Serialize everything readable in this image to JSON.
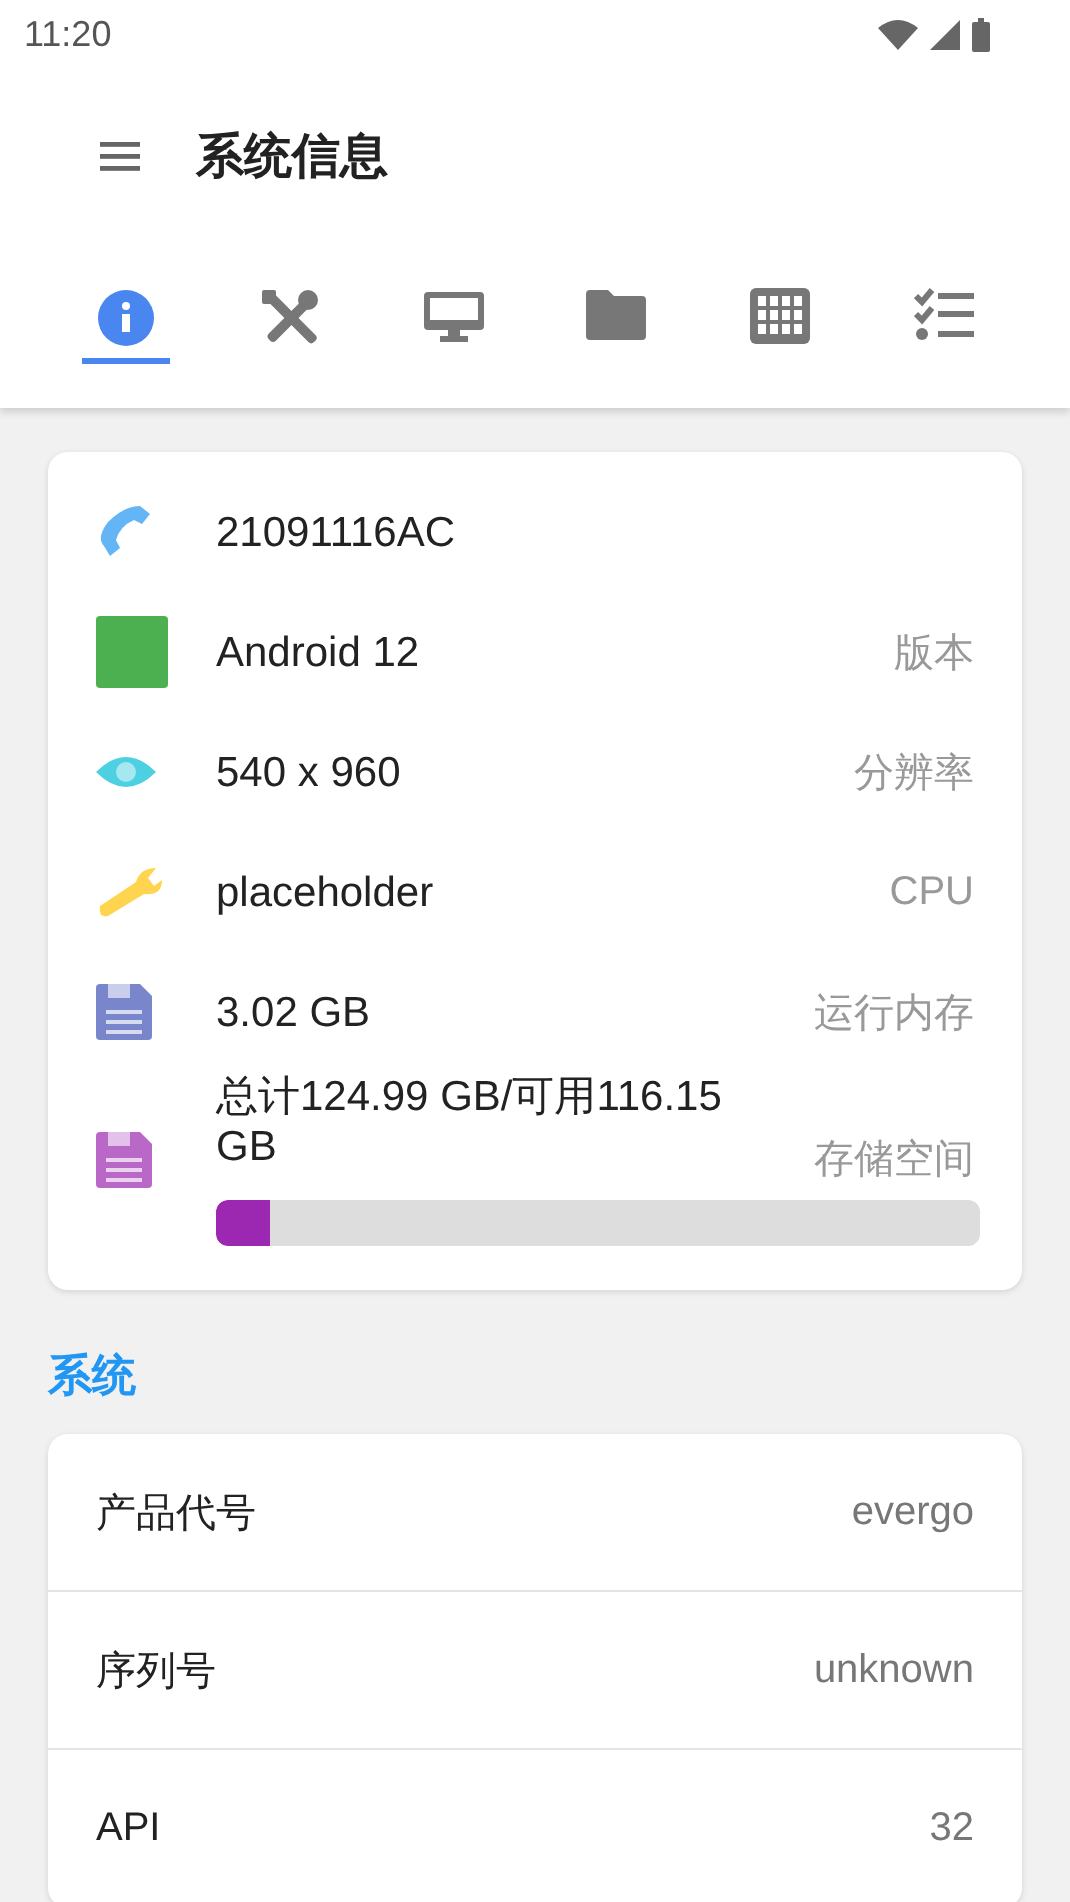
{
  "status_bar": {
    "time": "11:20"
  },
  "toolbar": {
    "title": "系统信息"
  },
  "tabs": [
    {
      "kind": "info",
      "selected": true
    },
    {
      "kind": "tools",
      "selected": false
    },
    {
      "kind": "monitor",
      "selected": false
    },
    {
      "kind": "folder",
      "selected": false
    },
    {
      "kind": "grid",
      "selected": false
    },
    {
      "kind": "checklist",
      "selected": false
    }
  ],
  "device": [
    {
      "kind": "phone",
      "color": "#64b5f6",
      "value": "21091116AC"
    },
    {
      "kind": "square",
      "color": "#4caf50",
      "value": "Android 12",
      "label": "版本"
    },
    {
      "kind": "eye",
      "color": "#4dd0e1",
      "value": "540 x 960",
      "label": "分辨率"
    },
    {
      "kind": "wrench",
      "color": "#ffd54f",
      "value": "placeholder",
      "label": "CPU"
    },
    {
      "kind": "floppy",
      "color": "#7986cb",
      "value": "3.02 GB",
      "label": "运行内存"
    },
    {
      "kind": "floppy",
      "color": "#ba68c8",
      "value": "总计124.99 GB/可用116.15 GB",
      "label": "存储空间",
      "level": 0.07
    }
  ],
  "system": {
    "title": "系统",
    "rows": [
      {
        "label": "产品代号",
        "value": "evergo"
      },
      {
        "label": "序列号",
        "value": "unknown"
      },
      {
        "label": "API",
        "value": "32"
      }
    ]
  }
}
